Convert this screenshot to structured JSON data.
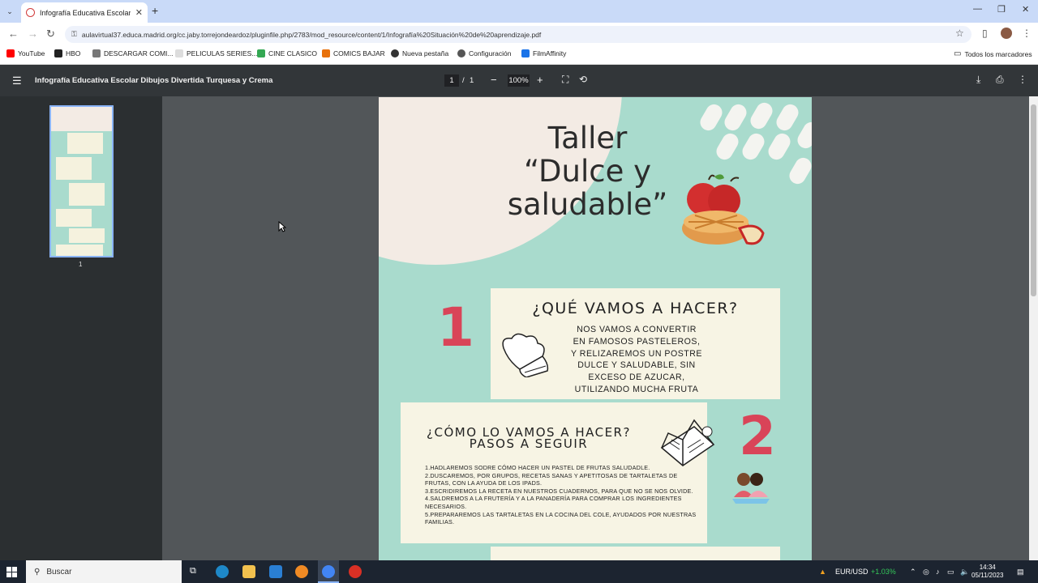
{
  "browser": {
    "tab_title": "Infografía Educativa Escolar Di",
    "url": "aulavirtual37.educa.madrid.org/cc.jaby.torrejondeardoz/pluginfile.php/2783/mod_resource/content/1/Infografía%20Situación%20de%20aprendizaje.pdf",
    "bookmarks": [
      {
        "label": "YouTube",
        "color": "#ff0000"
      },
      {
        "label": "HBO",
        "color": "#222222"
      },
      {
        "label": "DESCARGAR COMI...",
        "color": "#555555"
      },
      {
        "label": "PELICULAS SERIES...",
        "color": "#999999"
      },
      {
        "label": "CINE CLASICO",
        "color": "#34a853"
      },
      {
        "label": "COMICS BAJAR",
        "color": "#e8710a"
      },
      {
        "label": "Nueva pestaña",
        "color": "#333333"
      },
      {
        "label": "Configuración",
        "color": "#555555"
      },
      {
        "label": "FilmAffinity",
        "color": "#1a73e8"
      }
    ],
    "all_bookmarks": "Todos los marcadores"
  },
  "pdf": {
    "title": "Infografía Educativa Escolar Dibujos Divertida Turquesa y Crema",
    "page_current": "1",
    "page_separator": "/",
    "page_total": "1",
    "zoom": "100%",
    "thumb_page_number": "1"
  },
  "infographic": {
    "title_lines": [
      "Taller",
      "“Dulce y",
      "saludable”"
    ],
    "step1": {
      "number": "1",
      "heading": "¿QUÉ VAMOS A HACER?",
      "body_lines": [
        "NOS VAMOS A CONVERTIR",
        "EN FAMOSOS PASTELEROS,",
        "Y RELIZAREMOS UN POSTRE",
        "DULCE Y SALUDABLE, SIN",
        "EXCESO DE AZUCAR,",
        "UTILIZANDO MUCHA FRUTA"
      ]
    },
    "step2": {
      "number": "2",
      "heading_line1": "¿CÓMO LO VAMOS A HACER?",
      "heading_line2": "PASOS A SEGUIR",
      "items": [
        "1.Hadlaremos sodre cómo hacer un pastel de frutas saludadle.",
        "2.Duscaremos, por grupos, recetas sanas y apetitosas de tartaletas de frutas, con la ayuda de los ipads.",
        "3.Escridiremos la receta en nuestros cuadernos, para que no se nos olvide.",
        "4.Saldremos a la frutería y a la panadería para comprar los ingredientes necesarios.",
        "5.Prepararemos las tartaletas en la cocina del cole, ayudados por nuestras familias."
      ]
    }
  },
  "taskbar": {
    "search_placeholder": "Buscar",
    "ticker": "EUR/USD",
    "ticker_change": "+1.03%",
    "time": "14:34",
    "date": "05/11/2023"
  }
}
